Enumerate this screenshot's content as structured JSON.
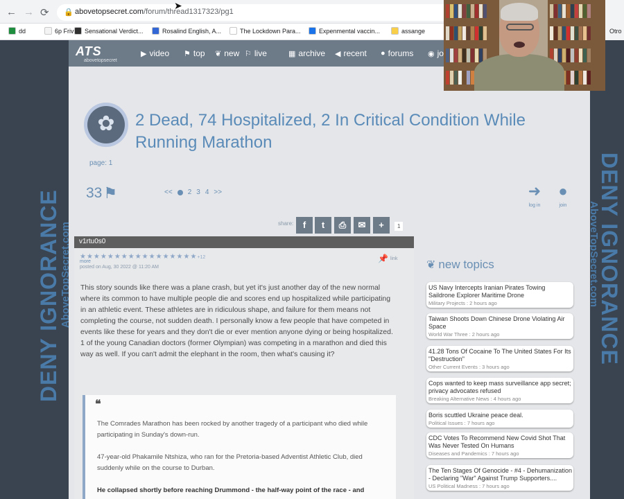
{
  "browser": {
    "back_icon": "←",
    "forward_icon": "→",
    "reload_icon": "⟳",
    "url_domain": "abovetopsecret.com",
    "url_path": "/forum/thread1317323/pg1",
    "edge_label": "Otro",
    "bookmarks": [
      {
        "label": "dd",
        "color": "#1e8e3e"
      },
      {
        "label": "6p  Friv",
        "color": "#f4f4f4"
      },
      {
        "label": "Sensational Verdict...",
        "color": "#303030"
      },
      {
        "label": "Rosalind English, A...",
        "color": "#3367d6"
      },
      {
        "label": "The Lockdown Para...",
        "color": "#ffffff"
      },
      {
        "label": "Expenmental vaccin...",
        "color": "#1a73e8"
      },
      {
        "label": "assange",
        "color": "#f9cf4a"
      }
    ]
  },
  "side": {
    "big": "DENY IGNORANCE",
    "small": "AboveTopSecret.com"
  },
  "site": {
    "logo_mark": "ATS",
    "logo_sub": "abovetopsecret",
    "nav": [
      {
        "label": "video",
        "icon": "▶"
      },
      {
        "label": "top",
        "icon": "⚑"
      },
      {
        "label": "new",
        "icon": "❦"
      },
      {
        "label": "live",
        "icon": "⚐"
      },
      {
        "label": "archive",
        "icon": "▦"
      },
      {
        "label": "recent",
        "icon": "◀"
      },
      {
        "label": "forums",
        "icon": "●"
      },
      {
        "label": "jo",
        "icon": "◉"
      }
    ]
  },
  "thread": {
    "title": "2 Dead, 74 Hospitalized, 2 In Critical Condition While Running Marathon",
    "page_label": "page: 1",
    "flag_count": "33",
    "pager": {
      "prev": "<<",
      "pages": [
        "2",
        "3",
        "4"
      ],
      "next": ">>"
    },
    "login": "log in",
    "join": "join",
    "share_label": "share:",
    "share_count": "1"
  },
  "post": {
    "author": "v1rtu0s0",
    "stars": "★★★★★★★★★★★★★★★★★",
    "stars_extra": "+12",
    "more": "more",
    "posted": "posted on Aug, 30 2022 @ 11:20 AM",
    "link": "link",
    "text": "This story sounds like there was a plane crash, but yet it's just another day of the new normal where its common to have multiple people die and scores end up hospitalized while participating in an athletic event. These athletes are in ridiculous shape, and failure for them means not completing the course, not sudden death. I personally know a few people that have competed in events like these for years and they don't die or ever mention anyone dying or being hospitalized. 1 of the young Canadian doctors (former Olympian) was competing in a marathon and died this way as well. If you can't admit the elephant in the room, then what's causing it?",
    "quote": {
      "mark": "❝",
      "p1": "The Comrades Marathon has been rocked by another tragedy of a participant who died while participating in Sunday's down-run.",
      "p2": "47-year-old Phakamile Ntshiza, who ran for the Pretoria-based Adventist Athletic Club, died suddenly while on the course to Durban.",
      "p3": "He collapsed shortly before reaching Drummond - the half-way point of the race - and"
    }
  },
  "new_topics": {
    "heading": "new topics",
    "items": [
      {
        "title": "US Navy Intercepts Iranian Pirates Towing Saildrone Explorer Maritime Drone",
        "meta": "Military Projects : 2 hours ago"
      },
      {
        "title": "Taiwan Shoots Down Chinese Drone Violating Air Space",
        "meta": "World War Three : 2 hours ago"
      },
      {
        "title": "41.28 Tons Of Cocaine To The United States For Its \"Destruction\"",
        "meta": "Other Current Events : 3 hours ago"
      },
      {
        "title": "Cops wanted to keep mass surveillance app secret; privacy advocates refused",
        "meta": "Breaking Alternative News : 4 hours ago"
      },
      {
        "title": "Boris scuttled Ukraine peace deal.",
        "meta": "Political Issues : 7 hours ago"
      },
      {
        "title": "CDC Votes To Recommend New Covid Shot That Was Never Tested On Humans",
        "meta": "Diseases and Pandemics : 7 hours ago"
      },
      {
        "title": "The Ten Stages Of Genocide - #4 - Dehumanization - Declaring \"War\" Against Trump Supporters....",
        "meta": "US Political Madness : 7 hours ago"
      }
    ]
  }
}
